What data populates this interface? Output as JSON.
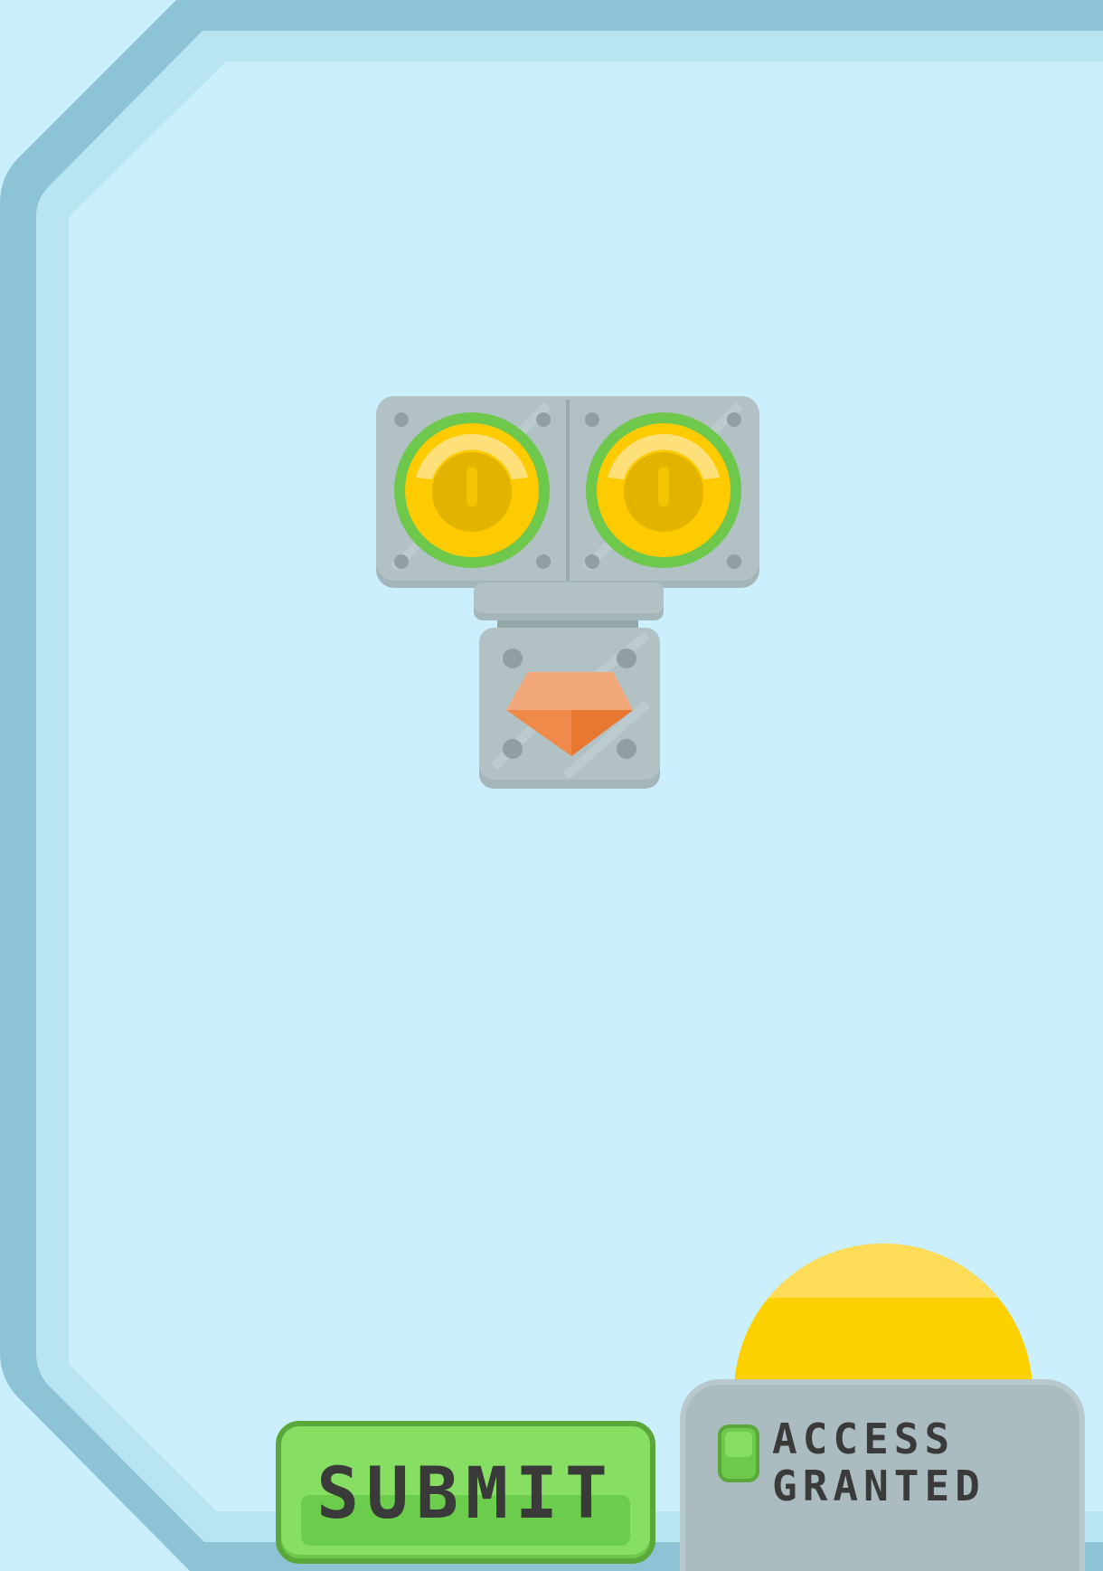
{
  "submit_button": {
    "label": "SUBMIT"
  },
  "status_display": {
    "line1": "ACCESS",
    "line2": "GRANTED",
    "indicator": "green-light"
  },
  "robot": {
    "parts": [
      "eye-left",
      "eye-right",
      "mouth-gem"
    ]
  },
  "colors": {
    "background": "#cbeffc",
    "frame": "#8cc4d6",
    "frame_inner": "#b9e5f3",
    "metal": "#abbcc0",
    "eye_ring": "#6ec84c",
    "eye_gold": "#fdcb00",
    "gem": "#ef8a4a",
    "button_green": "#86de63",
    "dome_yellow": "#fdd000"
  }
}
